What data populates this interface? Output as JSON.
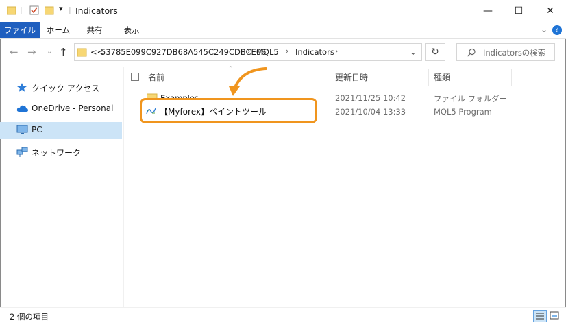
{
  "window": {
    "title": "Indicators",
    "minimize": "—",
    "maximize": "☐",
    "close": "✕"
  },
  "ribbon": {
    "tabs": [
      "ファイル",
      "ホーム",
      "共有",
      "表示"
    ],
    "expand": "⌄",
    "help": "?"
  },
  "address": {
    "overflow": "<<",
    "crumbs": [
      "53785E099C927DB68A545C249CDBCE06",
      "MQL5",
      "Indicators"
    ],
    "separator": "›"
  },
  "search": {
    "placeholder": "Indicatorsの検索"
  },
  "navpane": {
    "items": [
      {
        "label": "クイック アクセス",
        "icon": "star-pin-icon"
      },
      {
        "label": "OneDrive - Personal",
        "icon": "cloud-icon"
      },
      {
        "label": "PC",
        "icon": "monitor-icon",
        "selected": true
      },
      {
        "label": "ネットワーク",
        "icon": "network-icon"
      }
    ]
  },
  "columns": {
    "name": "名前",
    "modified": "更新日時",
    "type": "種類"
  },
  "files": [
    {
      "name": "Examples",
      "modified": "2021/11/25 10:42",
      "type": "ファイル フォルダー",
      "icon": "folder-icon"
    },
    {
      "name": "【Myforex】ペイントツール",
      "modified": "2021/10/04 13:33",
      "type": "MQL5 Program",
      "icon": "indicator-wave-icon"
    }
  ],
  "status": {
    "text": "2 個の項目"
  },
  "colors": {
    "accent": "#1f5fbf",
    "highlight": "#f0951e",
    "selected_nav": "#cce4f7"
  }
}
